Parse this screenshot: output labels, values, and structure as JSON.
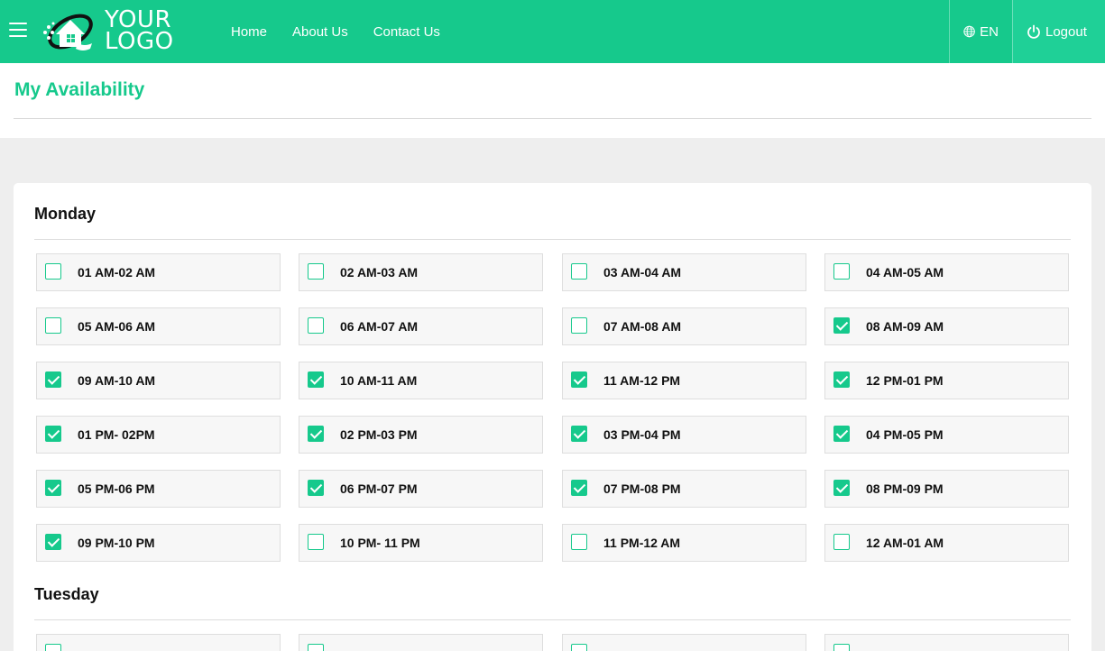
{
  "header": {
    "logo_line1": "YOUR",
    "logo_line2": "LOGO",
    "nav": [
      "Home",
      "About Us",
      "Contact Us"
    ],
    "language": "EN",
    "logout": "Logout",
    "brand_color": "#16c98c"
  },
  "page_title": "My Availability",
  "days": [
    {
      "name": "Monday",
      "slots": [
        {
          "label": "01 AM-02 AM",
          "checked": false
        },
        {
          "label": "02 AM-03 AM",
          "checked": false
        },
        {
          "label": "03 AM-04 AM",
          "checked": false
        },
        {
          "label": "04 AM-05 AM",
          "checked": false
        },
        {
          "label": "05 AM-06 AM",
          "checked": false
        },
        {
          "label": "06 AM-07 AM",
          "checked": false
        },
        {
          "label": "07 AM-08 AM",
          "checked": false
        },
        {
          "label": "08 AM-09 AM",
          "checked": true
        },
        {
          "label": "09 AM-10 AM",
          "checked": true
        },
        {
          "label": "10 AM-11 AM",
          "checked": true
        },
        {
          "label": "11 AM-12 PM",
          "checked": true
        },
        {
          "label": "12 PM-01 PM",
          "checked": true
        },
        {
          "label": "01 PM- 02PM",
          "checked": true
        },
        {
          "label": "02 PM-03 PM",
          "checked": true
        },
        {
          "label": "03 PM-04 PM",
          "checked": true
        },
        {
          "label": "04 PM-05 PM",
          "checked": true
        },
        {
          "label": "05 PM-06 PM",
          "checked": true
        },
        {
          "label": "06 PM-07 PM",
          "checked": true
        },
        {
          "label": "07 PM-08 PM",
          "checked": true
        },
        {
          "label": "08 PM-09 PM",
          "checked": true
        },
        {
          "label": "09 PM-10 PM",
          "checked": true
        },
        {
          "label": "10 PM- 11 PM",
          "checked": false
        },
        {
          "label": "11 PM-12 AM",
          "checked": false
        },
        {
          "label": "12 AM-01 AM",
          "checked": false
        }
      ]
    },
    {
      "name": "Tuesday",
      "slots": [
        {
          "label": "",
          "checked": false
        },
        {
          "label": "",
          "checked": false
        },
        {
          "label": "",
          "checked": false
        },
        {
          "label": "",
          "checked": false
        }
      ]
    }
  ]
}
